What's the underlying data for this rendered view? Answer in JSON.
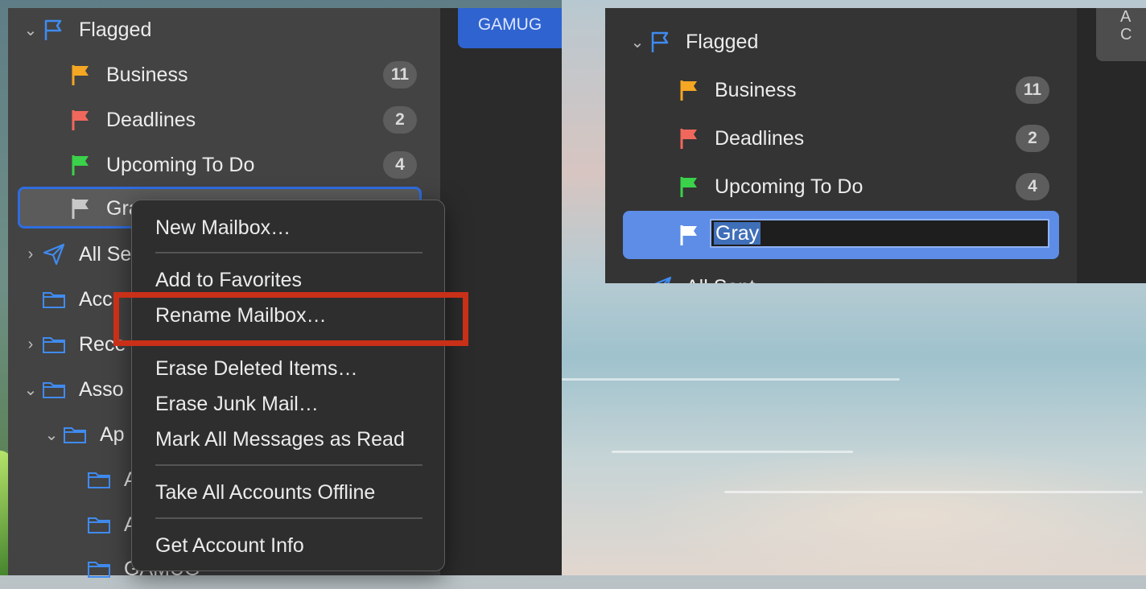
{
  "left_sidebar": {
    "flagged_label": "Flagged",
    "items": [
      {
        "label": "Business",
        "count": "11",
        "color": "#f5a623"
      },
      {
        "label": "Deadlines",
        "count": "2",
        "color": "#f0685c"
      },
      {
        "label": "Upcoming To Do",
        "count": "4",
        "color": "#3ad24a"
      },
      {
        "label": "Gra",
        "color": "#c8c8c8"
      }
    ],
    "rows_below": [
      "All Se",
      "Acc",
      "Rece",
      "Asso",
      "Ap",
      "A",
      "A",
      "GAMUG"
    ]
  },
  "gamug_button": "GAMUG",
  "context_menu": {
    "items": [
      "New Mailbox…",
      "Add to Favorites",
      "Rename Mailbox…",
      "Erase Deleted Items…",
      "Erase Junk Mail…",
      "Mark All Messages as Read",
      "Take All Accounts Offline",
      "Get Account Info"
    ],
    "highlight_color": "#c93018"
  },
  "right_panel": {
    "flagged_label": "Flagged",
    "items": [
      {
        "label": "Business",
        "count": "11"
      },
      {
        "label": "Deadlines",
        "count": "2"
      },
      {
        "label": "Upcoming To Do",
        "count": "4"
      }
    ],
    "rename_value": "Gray",
    "all_sent_label": "All Sent",
    "right_tab_text": "A\nC"
  },
  "colors": {
    "accent": "#2f6de0",
    "selection": "#5d8de6"
  }
}
